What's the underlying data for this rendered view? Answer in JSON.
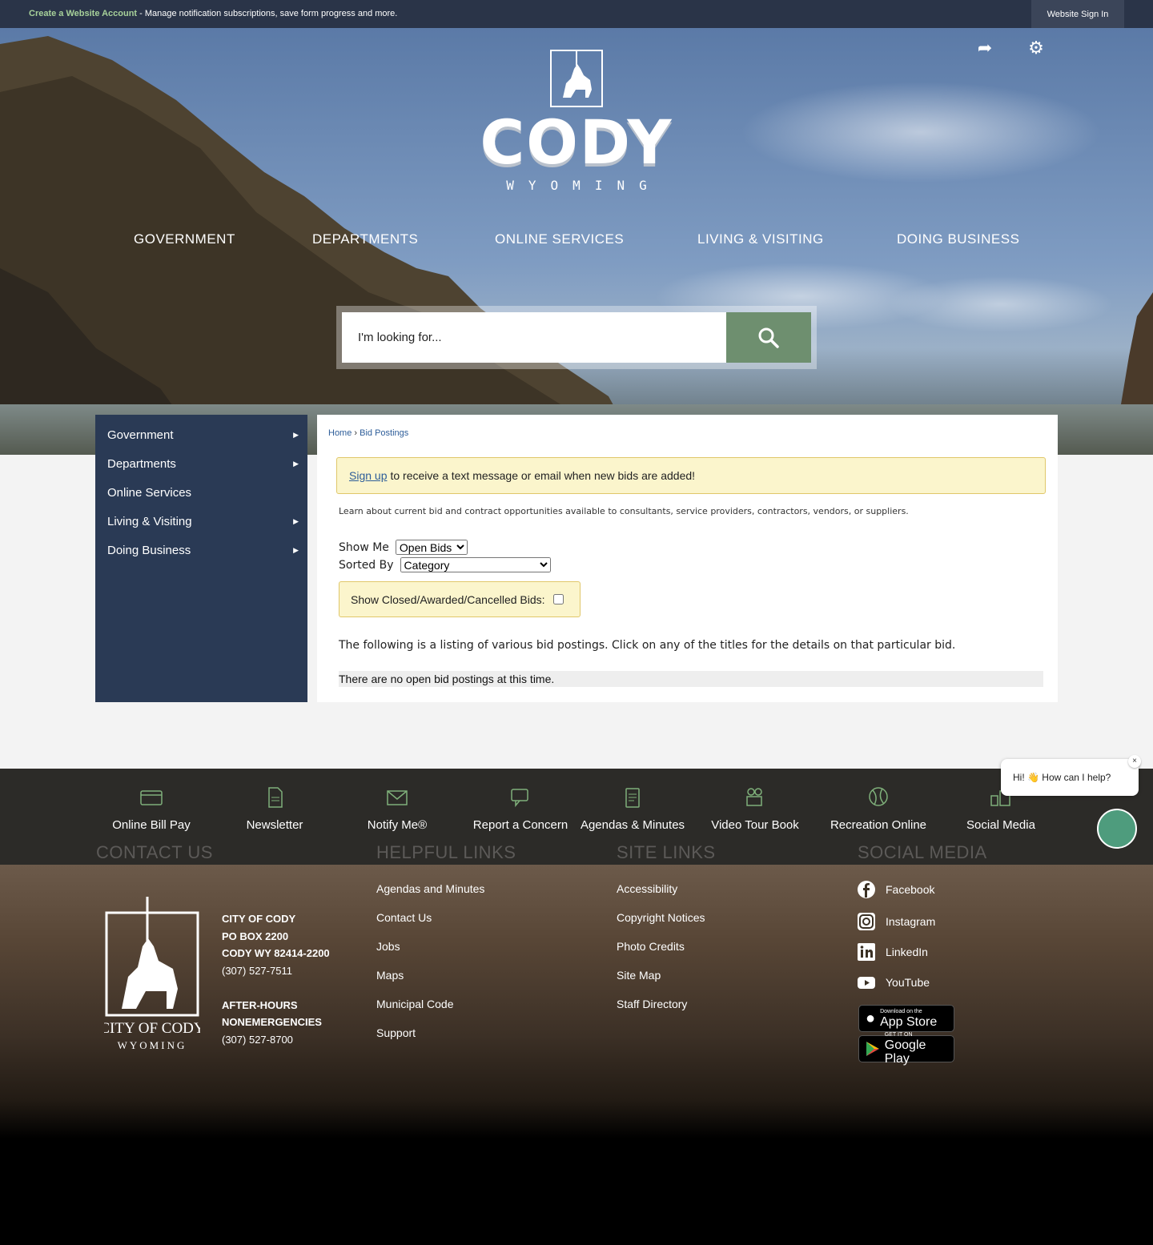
{
  "topbar": {
    "create_account": "Create a Website Account",
    "message": " - Manage notification subscriptions, save form progress and more.",
    "signin": "Website Sign In"
  },
  "logo": {
    "name": "CODY",
    "sub": "WYOMING"
  },
  "icons": {
    "share": "share-icon",
    "settings": "gear-icon",
    "search": "search-icon"
  },
  "nav": [
    "GOVERNMENT",
    "DEPARTMENTS",
    "ONLINE SERVICES",
    "LIVING & VISITING",
    "DOING BUSINESS"
  ],
  "search": {
    "placeholder": "I'm looking for..."
  },
  "sidebar": {
    "items": [
      {
        "label": "Government",
        "arrow": "▶"
      },
      {
        "label": "Departments",
        "arrow": "▶"
      },
      {
        "label": "Online Services",
        "arrow": ""
      },
      {
        "label": "Living & Visiting",
        "arrow": "▶"
      },
      {
        "label": "Doing Business",
        "arrow": "▶"
      }
    ]
  },
  "breadcrumb": {
    "home": "Home",
    "sep": " › ",
    "current": "Bid Postings"
  },
  "notice": {
    "link": "Sign up",
    "text": "to receive a text message or email when new bids are added!"
  },
  "learn": "Learn about current bid and contract opportunities available to consultants, service providers, contractors, vendors, or suppliers.",
  "filters": {
    "show_me_label": "Show Me",
    "show_me_value": "Open Bids",
    "sorted_by_label": "Sorted By",
    "sorted_by_value": "Category",
    "closed_label": "Show Closed/Awarded/Cancelled Bids:"
  },
  "listing": "The following is a listing of various bid postings. Click on any of the titles for the details on that particular bid.",
  "no_bids": "There are no open bid postings at this time.",
  "quick_links": [
    {
      "label": "Online Bill Pay",
      "icon": "credit-card-icon"
    },
    {
      "label": "Newsletter",
      "icon": "document-icon"
    },
    {
      "label": "Notify Me®",
      "icon": "envelope-icon"
    },
    {
      "label": "Report a Concern",
      "icon": "chat-icon"
    },
    {
      "label": "Agendas & Minutes",
      "icon": "clipboard-icon"
    },
    {
      "label": "Video Tour Book",
      "icon": "video-camera-icon"
    },
    {
      "label": "Recreation Online",
      "icon": "ball-icon"
    },
    {
      "label": "Social Media",
      "icon": "devices-icon"
    }
  ],
  "footer": {
    "contact_heading": "CONTACT US",
    "helpful_heading": "HELPFUL LINKS",
    "site_heading": "SITE LINKS",
    "social_heading": "SOCIAL MEDIA",
    "city_logo_text": "CITY OF CODY",
    "city_logo_sub": "WYOMING",
    "address": {
      "line1": "CITY OF CODY",
      "line2": "PO BOX 2200",
      "line3": "CODY WY 82414-2200",
      "phone": "(307) 527-7511",
      "after1": "AFTER-HOURS",
      "after2": "NONEMERGENCIES",
      "after_phone": "(307) 527-8700"
    },
    "helpful_links": [
      "Agendas and Minutes",
      "Contact Us",
      "Jobs",
      "Maps",
      "Municipal Code",
      "Support"
    ],
    "site_links": [
      "Accessibility",
      "Copyright Notices",
      "Photo Credits",
      "Site Map",
      "Staff Directory"
    ],
    "social": [
      "Facebook",
      "Instagram",
      "LinkedIn",
      "YouTube"
    ],
    "app_store": {
      "small": "Download on the",
      "big": "App Store"
    },
    "google_play": {
      "small": "GET IT ON",
      "big": "Google Play"
    }
  },
  "chat": {
    "greeting": "Hi! 👋 How can I help?",
    "close": "×"
  }
}
